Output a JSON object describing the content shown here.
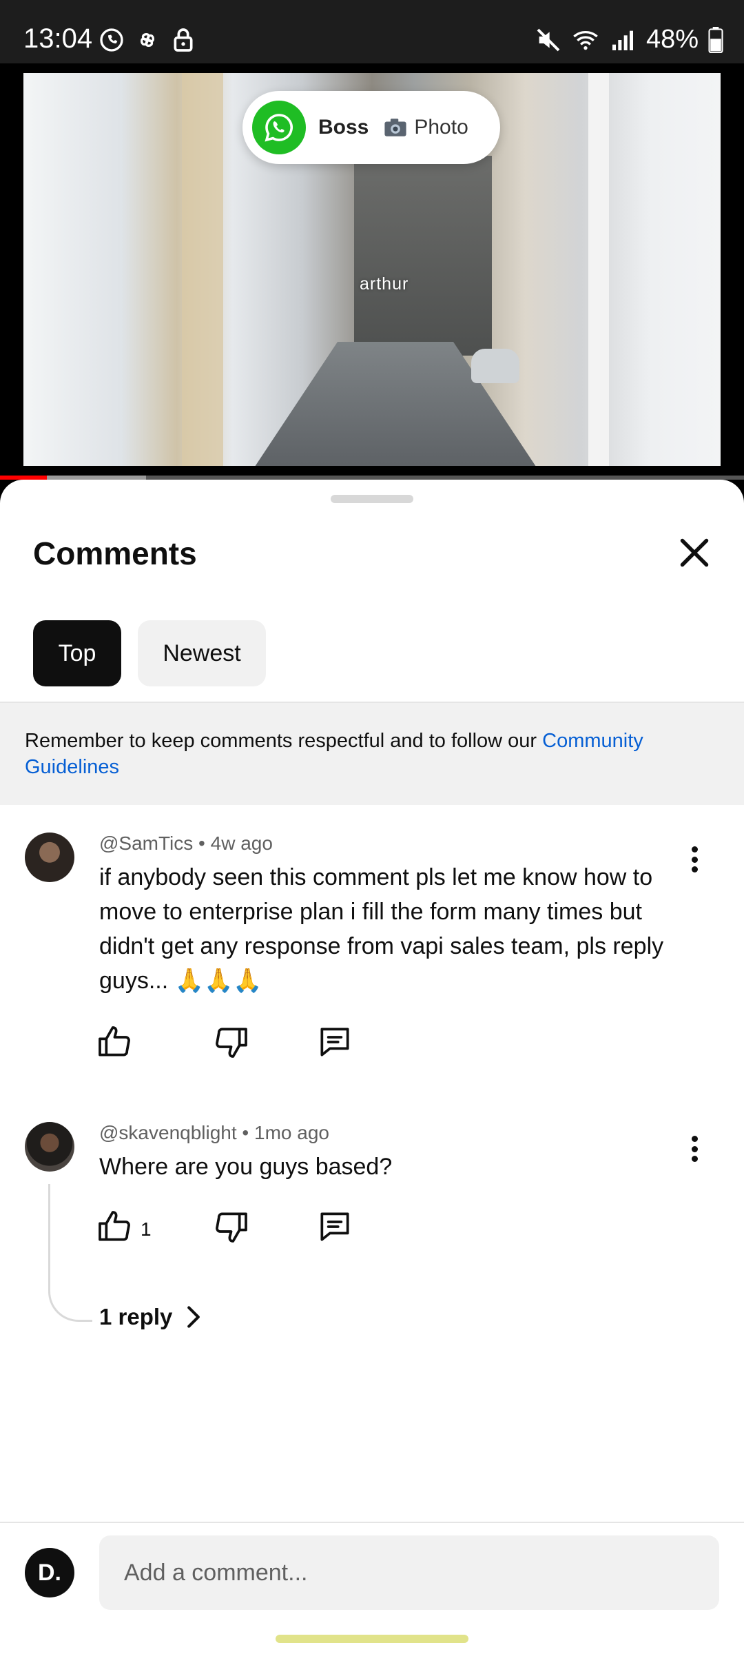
{
  "status_bar": {
    "time": "13:04",
    "battery": "48%",
    "left_icons": [
      "whatsapp-icon",
      "pinwheel-icon",
      "lock-icon"
    ],
    "right_icons": [
      "mute-icon",
      "wifi-icon",
      "signal-icon",
      "battery-icon"
    ]
  },
  "video": {
    "overlay_label": "arthur",
    "progress_played_fraction": 0.063,
    "progress_buffered_fraction": 0.196
  },
  "notification": {
    "app_icon": "whatsapp-icon",
    "sender": "Boss",
    "message": "Photo",
    "message_icon": "camera-icon"
  },
  "comments_panel": {
    "title": "Comments",
    "tabs": [
      {
        "label": "Top",
        "selected": true
      },
      {
        "label": "Newest",
        "selected": false
      }
    ],
    "guidelines_text": "Remember to keep comments respectful and to follow our ",
    "guidelines_link": "Community Guidelines",
    "comments": [
      {
        "author": "@SamTics",
        "time": "4w ago",
        "text": "if anybody seen this comment pls let me know how to move to enterprise plan i fill the form many times but didn't get any response from vapi sales team, pls reply guys... 🙏🙏🙏",
        "likes": ""
      },
      {
        "author": "@skavenqblight",
        "time": "1mo ago",
        "text": "Where are you guys based?",
        "likes": "1",
        "replies_label": "1 reply"
      }
    ],
    "composer": {
      "avatar_letter": "D.",
      "placeholder": "Add a comment..."
    }
  },
  "colors": {
    "accent_red": "#ff0000",
    "link_blue": "#065fd4",
    "whatsapp_green": "#1fbd24"
  }
}
